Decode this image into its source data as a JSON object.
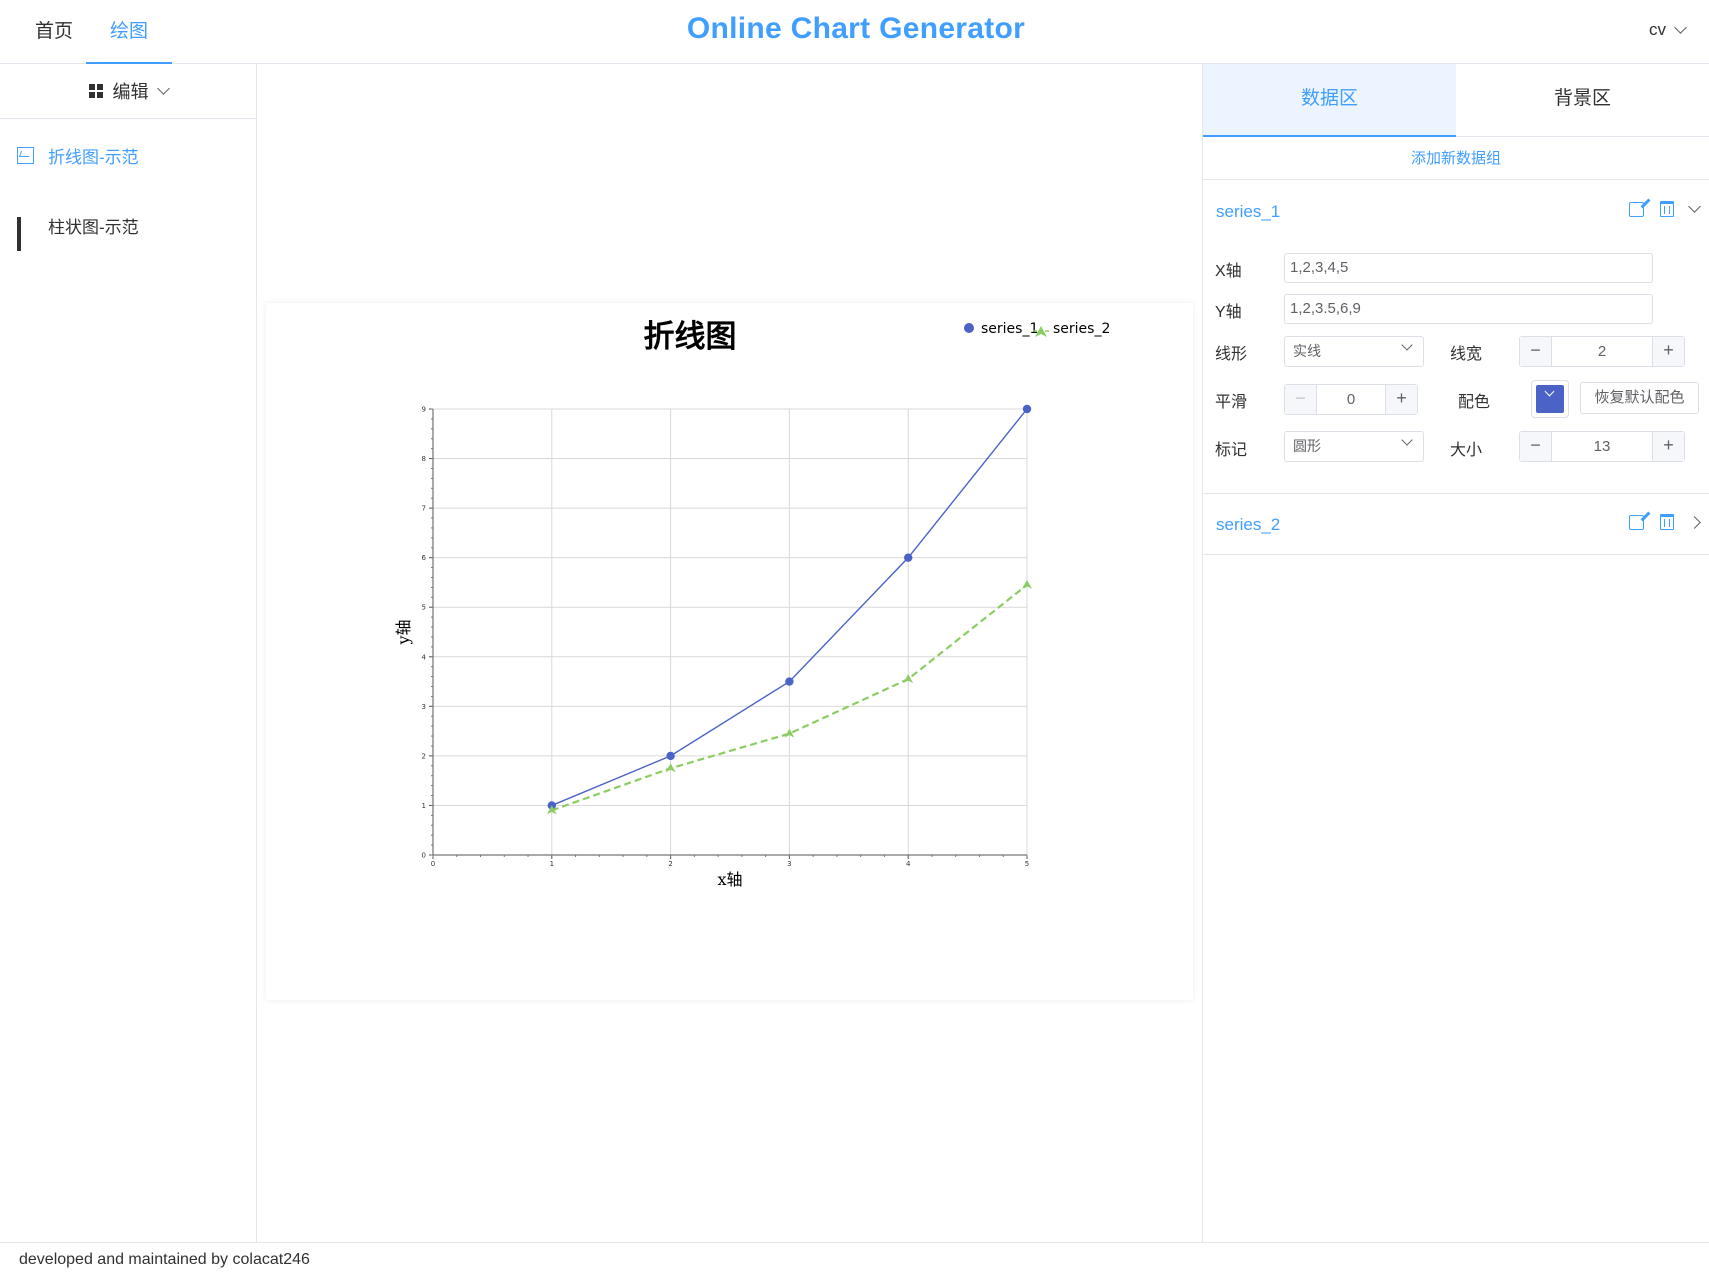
{
  "header": {
    "nav": [
      {
        "label": "首页"
      },
      {
        "label": "绘图"
      }
    ],
    "title": "Online Chart Generator",
    "user": "cv"
  },
  "sidebar": {
    "menu_label": "编辑",
    "items": [
      {
        "label": "折线图-示范",
        "icon": "line-chart-icon",
        "active": true
      },
      {
        "label": "柱状图-示范",
        "icon": "bar-chart-icon",
        "active": false
      }
    ]
  },
  "right_panel": {
    "tabs": [
      {
        "label": "数据区"
      },
      {
        "label": "背景区"
      }
    ],
    "add_group": "添加新数据组",
    "series": [
      {
        "name": "series_1",
        "expanded": true,
        "x_label": "X轴",
        "x_value": "1,2,3,4,5",
        "y_label": "Y轴",
        "y_value": "1,2,3.5,6,9",
        "line_style_label": "线形",
        "line_style": "实线",
        "line_width_label": "线宽",
        "line_width": "2",
        "smooth_label": "平滑",
        "smooth": "0",
        "color_label": "配色",
        "color": "#4b63c6",
        "reset_color": "恢复默认配色",
        "marker_label": "标记",
        "marker": "圆形",
        "size_label": "大小",
        "size": "13"
      },
      {
        "name": "series_2",
        "expanded": false
      }
    ]
  },
  "footer": {
    "text": "developed and maintained by colacat246"
  },
  "chart_data": {
    "type": "line",
    "title": "折线图",
    "xlabel": "x轴",
    "ylabel": "y轴",
    "xlim": [
      0,
      5
    ],
    "ylim": [
      0,
      9
    ],
    "xticks": [
      0,
      1,
      2,
      3,
      4,
      5
    ],
    "yticks": [
      0,
      1,
      2,
      3,
      4,
      5,
      6,
      7,
      8,
      9
    ],
    "grid": true,
    "legend": "top-right",
    "series": [
      {
        "name": "series_1",
        "x": [
          1,
          2,
          3,
          4,
          5
        ],
        "y": [
          1,
          2,
          3.5,
          6,
          9
        ],
        "color": "#4b63c6",
        "line": "solid",
        "marker": "circle"
      },
      {
        "name": "series_2",
        "x": [
          1,
          2,
          3,
          4,
          5
        ],
        "y": [
          0.9,
          1.75,
          2.45,
          3.55,
          5.45
        ],
        "color": "#8ccd63",
        "line": "dashed",
        "marker": "triangle"
      }
    ]
  }
}
